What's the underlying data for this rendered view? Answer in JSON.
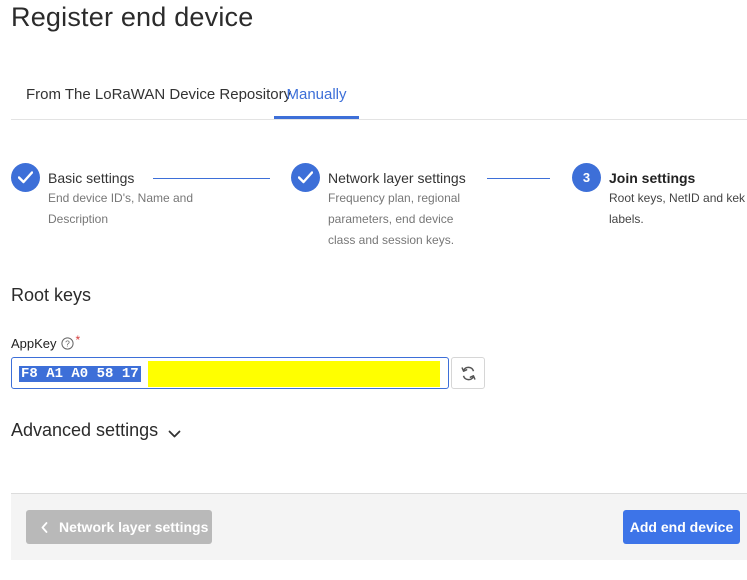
{
  "page": {
    "title": "Register end device"
  },
  "tabs": [
    {
      "label": "From The LoRaWAN Device Repository",
      "active": false
    },
    {
      "label": "Manually",
      "active": true
    }
  ],
  "steps": [
    {
      "title": "Basic settings",
      "desc_lines": [
        "End device ID's, Name and",
        "Description"
      ],
      "state": "done",
      "icon": "check-icon"
    },
    {
      "title": "Network layer settings",
      "desc_lines": [
        "Frequency plan, regional",
        "parameters, end device",
        "class and session keys."
      ],
      "state": "done",
      "icon": "check-icon"
    },
    {
      "number": "3",
      "title": "Join settings",
      "desc_lines": [
        "Root keys, NetID and kek",
        "labels."
      ],
      "state": "active"
    }
  ],
  "root_keys": {
    "title": "Root keys",
    "appkey": {
      "label": "AppKey",
      "required_mark": "*",
      "value": "F8 A1 A0 58 17",
      "regenerate_icon": "refresh-icon",
      "help_icon": "help-circle-icon"
    }
  },
  "advanced": {
    "label": "Advanced settings",
    "icon": "chevron-down-icon"
  },
  "footer": {
    "back_label": "Network layer settings",
    "back_icon": "chevron-left-icon",
    "submit_label": "Add end device"
  },
  "colors": {
    "accent": "#3d6fd8",
    "redaction": "#ffff00",
    "disabled_button": "#b9b9b9",
    "required": "#d43b3b"
  }
}
